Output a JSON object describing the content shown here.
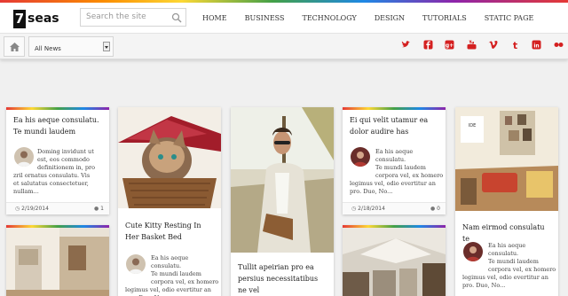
{
  "brand": {
    "number": "7",
    "word": "seas"
  },
  "search": {
    "placeholder": "Search the site"
  },
  "nav": [
    "HOME",
    "BUSINESS",
    "TECHNOLOGY",
    "DESIGN",
    "TUTORIALS",
    "STATIC PAGE"
  ],
  "category_select": {
    "value": "All News"
  },
  "social": [
    "twitter-icon",
    "facebook-icon",
    "google-plus-icon",
    "youtube-icon",
    "vimeo-icon",
    "tumblr-icon",
    "linkedin-icon",
    "flickr-icon"
  ],
  "colors": {
    "accent": "#d42020",
    "nav_text": "#333333",
    "page_bg": "#f0f0f0"
  },
  "cards": [
    {
      "title": "Ea his aeque consulatu. Te mundi laudem",
      "excerpt": [
        "Doming invidunt ut",
        "est, eos commodo",
        "definitionem in, pro",
        "zril ornatus consulatu. Vis",
        "et salutatus consectetuer, nullam..."
      ],
      "date": "2/19/2014",
      "comments": "1"
    },
    {
      "title": "Cute Kitty Resting In Her Basket Bed",
      "excerpt": [
        "Ea his aeque consulatu.",
        "Te mundi laudem",
        "corpora vel, ex homero",
        "legimus vel, odio evertitur an",
        "pro. Duo, No..."
      ]
    },
    {
      "title": "Tullit apeirian pro ea persius necessitatibus ne vel"
    },
    {
      "title": "Ei qui velit utamur ea dolor audire has",
      "date": "2/18/2014",
      "comments": "0"
    },
    {
      "title": "Nam eirmod consulatu te",
      "excerpt": [
        "Ea his aeque consulatu.",
        "Te mundi laudem",
        "corpora vel, ex homero",
        "legimus vel, odio evertitur an",
        "pro. Duo, No..."
      ]
    }
  ]
}
